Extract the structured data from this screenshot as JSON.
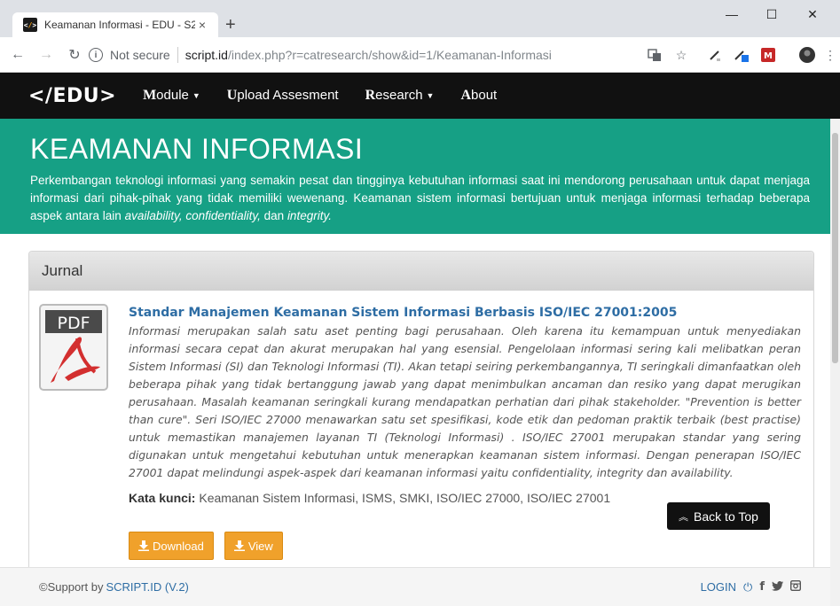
{
  "browser": {
    "tab_title": "Keamanan Informasi - EDU - S2",
    "tab_close": "×",
    "new_tab": "+",
    "win_min": "—",
    "win_max": "☐",
    "win_close": "✕",
    "security_label": "Not secure",
    "url_host": "script.id",
    "url_path": "/index.php?r=catresearch/show&id=1/Keamanan-Informasi"
  },
  "nav": {
    "brand_left": "</",
    "brand_text": "EDU>",
    "items": [
      {
        "initial": "M",
        "rest": "odule",
        "caret": true
      },
      {
        "initial": "U",
        "rest": "pload Assesment",
        "caret": false
      },
      {
        "initial": "R",
        "rest": "esearch",
        "caret": true
      },
      {
        "initial": "A",
        "rest": "bout",
        "caret": false
      }
    ]
  },
  "hero": {
    "title": "KEAMANAN INFORMASI",
    "desc_main": "Perkembangan teknologi informasi yang semakin pesat dan tingginya kebutuhan informasi saat ini mendorong perusahaan untuk dapat menjaga informasi dari pihak-pihak yang tidak memiliki wewenang. Keamanan sistem informasi bertujuan untuk menjaga informasi terhadap beberapa aspek antara lain ",
    "desc_terms": "availability, confidentiality,",
    "desc_and": " dan ",
    "desc_last": "integrity."
  },
  "panel": {
    "heading": "Jurnal",
    "pdf_label": "PDF",
    "article": {
      "title": "Standar Manajemen Keamanan Sistem Informasi Berbasis ISO/IEC 27001:2005",
      "abstract": "Informasi merupakan salah satu aset penting bagi perusahaan. Oleh karena itu kemampuan untuk menyediakan informasi secara cepat dan akurat merupakan hal yang esensial. Pengelolaan informasi sering kali melibatkan peran Sistem Informasi (SI) dan Teknologi Informasi (TI). Akan tetapi seiring perkembangannya, TI seringkali dimanfaatkan oleh beberapa pihak yang tidak bertanggung jawab yang dapat menimbulkan ancaman dan resiko yang dapat merugikan perusahaan. Masalah keamanan seringkali kurang mendapatkan perhatian dari pihak stakeholder. \"Prevention is better than cure\". Seri ISO/IEC 27000 menawarkan satu set spesifikasi, kode etik dan pedoman praktik terbaik (best practise) untuk memastikan manajemen layanan TI (Teknologi Informasi) . ISO/IEC 27001 merupakan standar yang sering digunakan untuk mengetahui kebutuhan untuk menerapkan keamanan sistem informasi. Dengan penerapan ISO/IEC 27001 dapat melindungi aspek-aspek dari keamanan informasi yaitu confidentiality, integrity dan availability.",
      "keywords_label": "Kata kunci:",
      "keywords": " Keamanan Sistem Informasi, ISMS, SMKI, ISO/IEC 27000, ISO/IEC 27001",
      "download_label": "Download",
      "view_label": "View"
    }
  },
  "back_to_top": "Back to Top",
  "footer": {
    "support_prefix": "©Support by ",
    "support_link": "SCRIPT.ID (V.2)",
    "login": "LOGIN"
  },
  "colors": {
    "hero_bg": "#16a085",
    "nav_bg": "#111111",
    "accent_orange": "#f0a12b",
    "link_blue": "#2e6da4"
  }
}
